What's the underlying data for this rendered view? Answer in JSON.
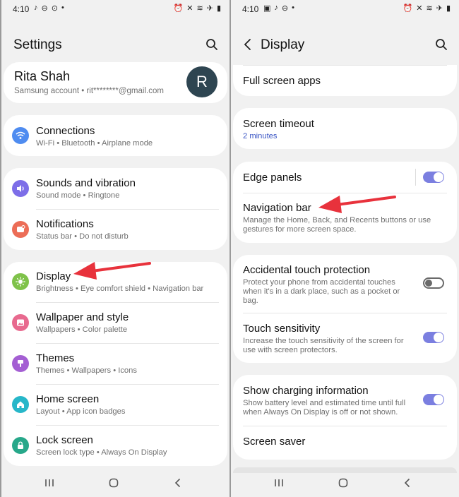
{
  "left": {
    "status": {
      "time": "4:10"
    },
    "title": "Settings",
    "account": {
      "name": "Rita Shah",
      "detail": "Samsung account  •  rit********@gmail.com",
      "avatar_letter": "R"
    },
    "items": [
      {
        "title": "Connections",
        "subtitle": "Wi-Fi  •  Bluetooth  •  Airplane mode",
        "icon": "wifi-icon",
        "color": "#4f8cf0"
      },
      {
        "title": "Sounds and vibration",
        "subtitle": "Sound mode  •  Ringtone",
        "icon": "volume-icon",
        "color": "#7d6ee8"
      },
      {
        "title": "Notifications",
        "subtitle": "Status bar  •  Do not disturb",
        "icon": "bell-icon",
        "color": "#ec6d57"
      },
      {
        "title": "Display",
        "subtitle": "Brightness  •  Eye comfort shield  •  Navigation bar",
        "icon": "sun-icon",
        "color": "#7fc24a"
      },
      {
        "title": "Wallpaper and style",
        "subtitle": "Wallpapers  •  Color palette",
        "icon": "image-icon",
        "color": "#e86a8f"
      },
      {
        "title": "Themes",
        "subtitle": "Themes  •  Wallpapers  •  Icons",
        "icon": "brush-icon",
        "color": "#a45fd3"
      },
      {
        "title": "Home screen",
        "subtitle": "Layout  •  App icon badges",
        "icon": "home-icon",
        "color": "#27b7c9"
      },
      {
        "title": "Lock screen",
        "subtitle": "Screen lock type  •  Always On Display",
        "icon": "lock-icon",
        "color": "#27a88a"
      }
    ]
  },
  "right": {
    "status": {
      "time": "4:10"
    },
    "title": "Display",
    "items": [
      {
        "title": "Full screen apps"
      },
      {
        "title": "Screen timeout",
        "subtitle": "2 minutes"
      },
      {
        "title": "Edge panels",
        "toggle": true
      },
      {
        "title": "Navigation bar",
        "subtitle": "Manage the Home, Back, and Recents buttons or use gestures for more screen space."
      },
      {
        "title": "Accidental touch protection",
        "subtitle": "Protect your phone from accidental touches when it's in a dark place, such as a pocket or bag.",
        "toggle": false
      },
      {
        "title": "Touch sensitivity",
        "subtitle": "Increase the touch sensitivity of the screen for use with screen protectors.",
        "toggle": true
      },
      {
        "title": "Show charging information",
        "subtitle": "Show battery level and estimated time until full when Always On Display is off or not shown.",
        "toggle": true
      },
      {
        "title": "Screen saver"
      }
    ]
  },
  "colors": {
    "accent": "#7b7fe0",
    "arrow": "#e8323c",
    "avatar": "#2e4551"
  }
}
